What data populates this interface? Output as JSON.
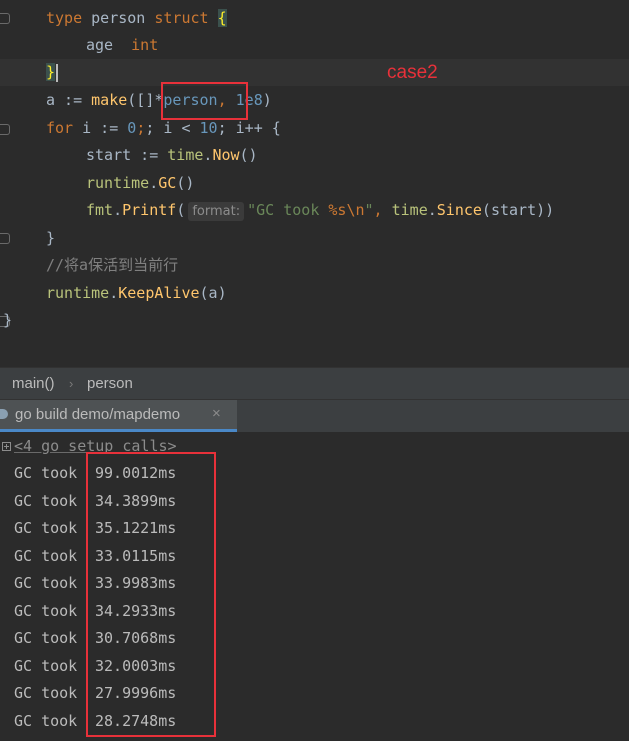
{
  "editor": {
    "lines": {
      "l1": {
        "kw1": "type",
        "name": "person",
        "kw2": "struct",
        "brace": "{"
      },
      "l2": {
        "field": "age",
        "type": "int"
      },
      "l3": {
        "brace": "}"
      },
      "l4": {
        "pre": "a := ",
        "fn": "make",
        "open": "([]",
        "star": "*",
        "typ": "person",
        "comma": ",",
        "num": "1e8",
        "close": ")"
      },
      "l5": {
        "kw": "for",
        "a": " i := ",
        "n0": "0",
        "b": "; i < ",
        "n10": "10",
        "c": "; i++ {"
      },
      "l6": {
        "pre": "start := ",
        "pkg": "time",
        "dot": ".",
        "fn": "Now",
        "close": "()"
      },
      "l7": {
        "pkg": "runtime",
        "dot": ".",
        "fn": "GC",
        "close": "()"
      },
      "l8": {
        "pkg": "fmt",
        "dot": ".",
        "fn": "Printf",
        "open": "(",
        "hint": "format:",
        "str1": "\"GC took ",
        "esc1": "%s\\n",
        "str2": "\"",
        "sep": ", ",
        "pkg2": "time",
        "dot2": ".",
        "fn2": "Since",
        "arg": "(start))"
      },
      "l9": {
        "brace": "}"
      },
      "l10": {
        "comment": "//将a保活到当前行"
      },
      "l11": {
        "pkg": "runtime",
        "dot": ".",
        "fn": "KeepAlive",
        "arg": "(a)"
      },
      "l12": {
        "brace": "}"
      }
    },
    "annotation": "case2"
  },
  "breadcrumb": {
    "items": [
      "main()",
      "person"
    ],
    "separator": "›"
  },
  "run": {
    "tab_label": "go build demo/mapdemo",
    "close": "×"
  },
  "console": {
    "setup": "<4 go setup calls>",
    "prefix": "GC took",
    "times": [
      "99.0012ms",
      "34.3899ms",
      "35.1221ms",
      "33.0115ms",
      "33.9983ms",
      "34.2933ms",
      "30.7068ms",
      "32.0003ms",
      "27.9996ms",
      "28.2748ms"
    ]
  },
  "colors": {
    "annotation_red": "#e8313a",
    "keyword": "#cc7832",
    "function": "#ffc66d",
    "number": "#6897bb",
    "string": "#6a8759"
  }
}
